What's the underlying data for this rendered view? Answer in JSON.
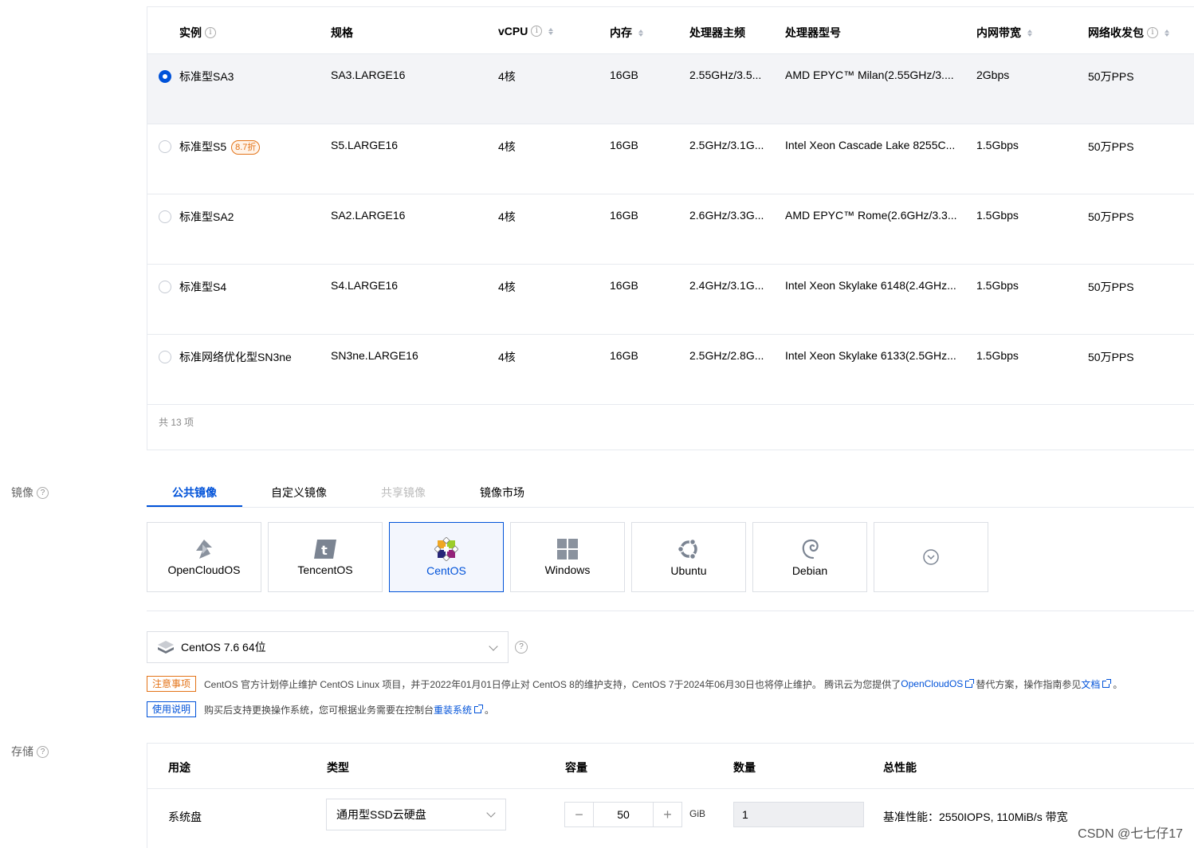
{
  "instance_table": {
    "columns": [
      {
        "label": "实例",
        "info": true,
        "sort": false
      },
      {
        "label": "规格",
        "info": false,
        "sort": false
      },
      {
        "label": "vCPU",
        "info": true,
        "sort": true
      },
      {
        "label": "内存",
        "info": false,
        "sort": true
      },
      {
        "label": "处理器主频",
        "info": false,
        "sort": false
      },
      {
        "label": "处理器型号",
        "info": false,
        "sort": false
      },
      {
        "label": "内网带宽",
        "info": false,
        "sort": true
      },
      {
        "label": "网络收发包",
        "info": true,
        "sort": true
      }
    ],
    "rows": [
      {
        "name": "标准型SA3",
        "badge": "",
        "spec": "SA3.LARGE16",
        "vcpu": "4核",
        "mem": "16GB",
        "freq": "2.55GHz/3.5...",
        "model": "AMD EPYC™ Milan(2.55GHz/3....",
        "bw": "2Gbps",
        "pps": "50万PPS",
        "selected": true
      },
      {
        "name": "标准型S5",
        "badge": "8.7折",
        "spec": "S5.LARGE16",
        "vcpu": "4核",
        "mem": "16GB",
        "freq": "2.5GHz/3.1G...",
        "model": "Intel Xeon Cascade Lake 8255C...",
        "bw": "1.5Gbps",
        "pps": "50万PPS",
        "selected": false
      },
      {
        "name": "标准型SA2",
        "badge": "",
        "spec": "SA2.LARGE16",
        "vcpu": "4核",
        "mem": "16GB",
        "freq": "2.6GHz/3.3G...",
        "model": "AMD EPYC™ Rome(2.6GHz/3.3...",
        "bw": "1.5Gbps",
        "pps": "50万PPS",
        "selected": false
      },
      {
        "name": "标准型S4",
        "badge": "",
        "spec": "S4.LARGE16",
        "vcpu": "4核",
        "mem": "16GB",
        "freq": "2.4GHz/3.1G...",
        "model": "Intel Xeon Skylake 6148(2.4GHz...",
        "bw": "1.5Gbps",
        "pps": "50万PPS",
        "selected": false
      },
      {
        "name": "标准网络优化型SN3ne",
        "badge": "",
        "spec": "SN3ne.LARGE16",
        "vcpu": "4核",
        "mem": "16GB",
        "freq": "2.5GHz/2.8G...",
        "model": "Intel Xeon Skylake 6133(2.5GHz...",
        "bw": "1.5Gbps",
        "pps": "50万PPS",
        "selected": false
      }
    ],
    "total": "共 13 项"
  },
  "image": {
    "label": "镜像",
    "tabs": [
      {
        "label": "公共镜像",
        "state": "active"
      },
      {
        "label": "自定义镜像",
        "state": "normal"
      },
      {
        "label": "共享镜像",
        "state": "disabled"
      },
      {
        "label": "镜像市场",
        "state": "normal"
      }
    ],
    "os_options": [
      {
        "name": "OpenCloudOS",
        "icon": "opencloudos-icon",
        "active": false
      },
      {
        "name": "TencentOS",
        "icon": "tencentos-icon",
        "active": false
      },
      {
        "name": "CentOS",
        "icon": "centos-icon",
        "active": true
      },
      {
        "name": "Windows",
        "icon": "windows-icon",
        "active": false
      },
      {
        "name": "Ubuntu",
        "icon": "ubuntu-icon",
        "active": false
      },
      {
        "name": "Debian",
        "icon": "debian-icon",
        "active": false
      },
      {
        "name": "",
        "icon": "expand-more-icon",
        "active": false
      }
    ],
    "version": "CentOS 7.6 64位",
    "notice": {
      "tag": "注意事项",
      "text1": "CentOS 官方计划停止维护 CentOS Linux 项目，并于2022年01月01日停止对 CentOS 8的维护支持，CentOS 7于2024年06月30日也将停止维护。 腾讯云为您提供了",
      "link1": "OpenCloudOS",
      "text2": " 替代方案，操作指南参见",
      "link2": "文档",
      "text3": " 。"
    },
    "usage": {
      "tag": "使用说明",
      "text1": "购买后支持更换操作系统，您可根据业务需要在控制台",
      "link1": "重装系统",
      "text2": " 。"
    }
  },
  "storage": {
    "label": "存储",
    "columns": [
      "用途",
      "类型",
      "容量",
      "数量",
      "总性能"
    ],
    "row": {
      "usage": "系统盘",
      "type": "通用型SSD云硬盘",
      "capacity": "50",
      "unit": "GiB",
      "count": "1",
      "perf": "基准性能：2550IOPS, 110MiB/s 带宽"
    }
  },
  "watermark": "CSDN @七七仔17",
  "colors": {
    "primary": "#0052d9",
    "warning": "#e37318",
    "border": "#e7eaef"
  }
}
